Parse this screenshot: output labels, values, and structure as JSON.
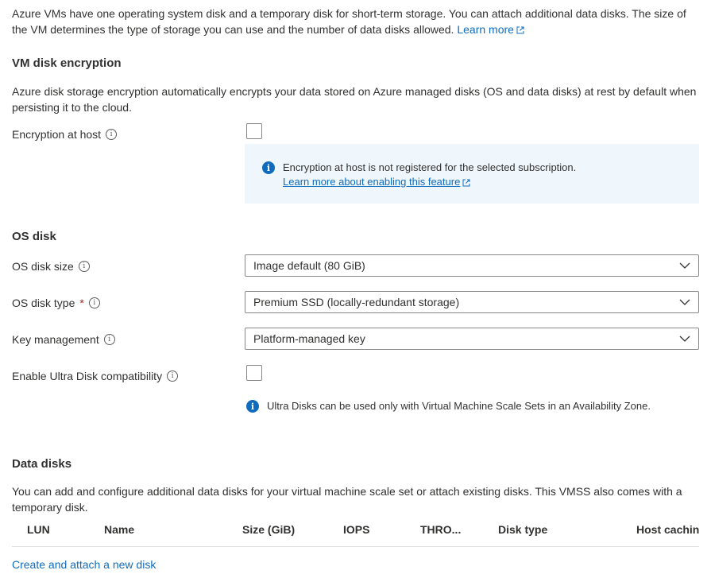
{
  "intro": {
    "text": "Azure VMs have one operating system disk and a temporary disk for short-term storage. You can attach additional data disks. The size of the VM determines the type of storage you can use and the number of data disks allowed.",
    "learn_more": "Learn more"
  },
  "encryption": {
    "title": "VM disk encryption",
    "description": "Azure disk storage encryption automatically encrypts your data stored on Azure managed disks (OS and data disks) at rest by default when persisting it to the cloud.",
    "host_label": "Encryption at host",
    "host_checked": false,
    "info_text": "Encryption at host is not registered for the selected subscription.",
    "info_link": "Learn more about enabling this feature"
  },
  "os_disk": {
    "title": "OS disk",
    "size_label": "OS disk size",
    "size_value": "Image default (80 GiB)",
    "type_label": "OS disk type",
    "type_required": "*",
    "type_value": "Premium SSD (locally-redundant storage)",
    "key_label": "Key management",
    "key_value": "Platform-managed key",
    "ultra_label": "Enable Ultra Disk compatibility",
    "ultra_checked": false,
    "ultra_info": "Ultra Disks can be used only with Virtual Machine Scale Sets in an Availability Zone."
  },
  "data_disks": {
    "title": "Data disks",
    "description": "You can add and configure additional data disks for your virtual machine scale set or attach existing disks. This VMSS also comes with a temporary disk.",
    "columns": [
      "LUN",
      "Name",
      "Size (GiB)",
      "IOPS",
      "THRO...",
      "Disk type",
      "Host cachin"
    ],
    "create_link": "Create and attach a new disk"
  },
  "colors": {
    "accent": "#0f6cbd",
    "info_bg": "#eff6fc",
    "required": "#a4262c",
    "text": "#323130"
  },
  "icons": [
    "external-link-icon",
    "info-tooltip-icon",
    "info-filled-icon",
    "chevron-down-icon"
  ]
}
